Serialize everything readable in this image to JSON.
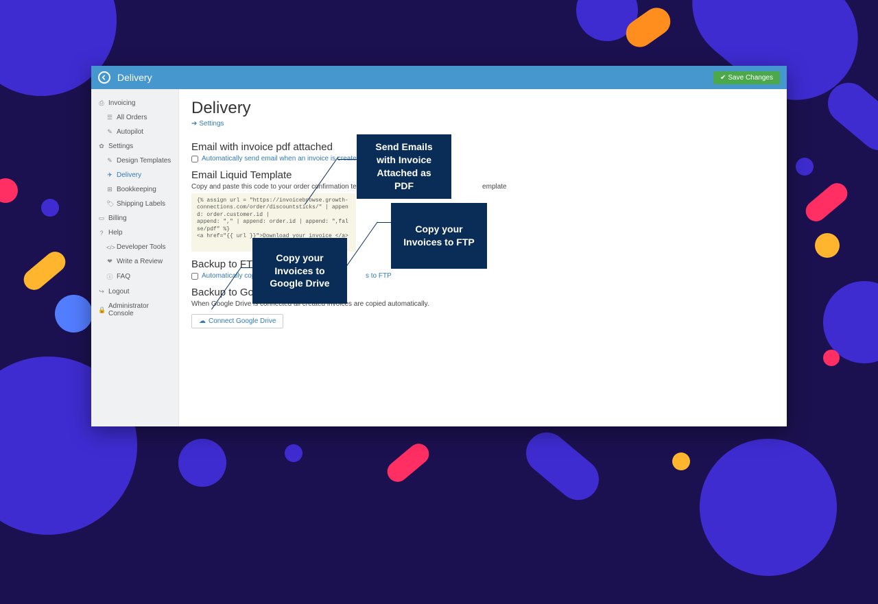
{
  "topbar": {
    "title": "Delivery",
    "save_label": "Save Changes"
  },
  "sidebar": {
    "invoicing": {
      "label": "Invoicing",
      "all_orders": "All Orders",
      "autopilot": "Autopilot"
    },
    "settings": {
      "label": "Settings",
      "design": "Design Templates",
      "delivery": "Delivery",
      "bookkeeping": "Bookkeeping",
      "shipping": "Shipping Labels"
    },
    "billing": {
      "label": "Billing"
    },
    "help": {
      "label": "Help",
      "dev": "Developer Tools",
      "review": "Write a Review",
      "faq": "FAQ"
    },
    "logout": "Logout",
    "admin": "Administrator Console"
  },
  "content": {
    "title": "Delivery",
    "settings_link": "Settings",
    "email_attach_h": "Email with invoice pdf attached",
    "email_attach_chk": "Automatically send email when an invoice is created.",
    "liquid_h": "Email Liquid Template",
    "liquid_desc_a": "Copy and paste this code to your order confirmation template. C",
    "liquid_desc_b": "emplate",
    "code": "{% assign url = \"https://invoicebrowse.growth-\nconnections.com/order/discountsticks/\" | append: order.customer.id |\nappend: \",\" | append: order.id | append: \",false/pdf\" %}\n<a href=\"{{ url }}\">Download your invoice </a>",
    "ftp_h": "Backup to FTP",
    "ftp_chk_a": "Automatically copy in",
    "ftp_chk_b": "s to FTP",
    "gdrive_h": "Backup to Goog",
    "gdrive_desc": "When Google Drive is connected all created invoices are copied automatically.",
    "gdrive_btn": "Connect Google Drive"
  },
  "callouts": {
    "email": "Send Emails with Invoice Attached as PDF",
    "ftp": "Copy your Invoices to FTP",
    "gdrive": "Copy your Invoices to Google Drive"
  }
}
